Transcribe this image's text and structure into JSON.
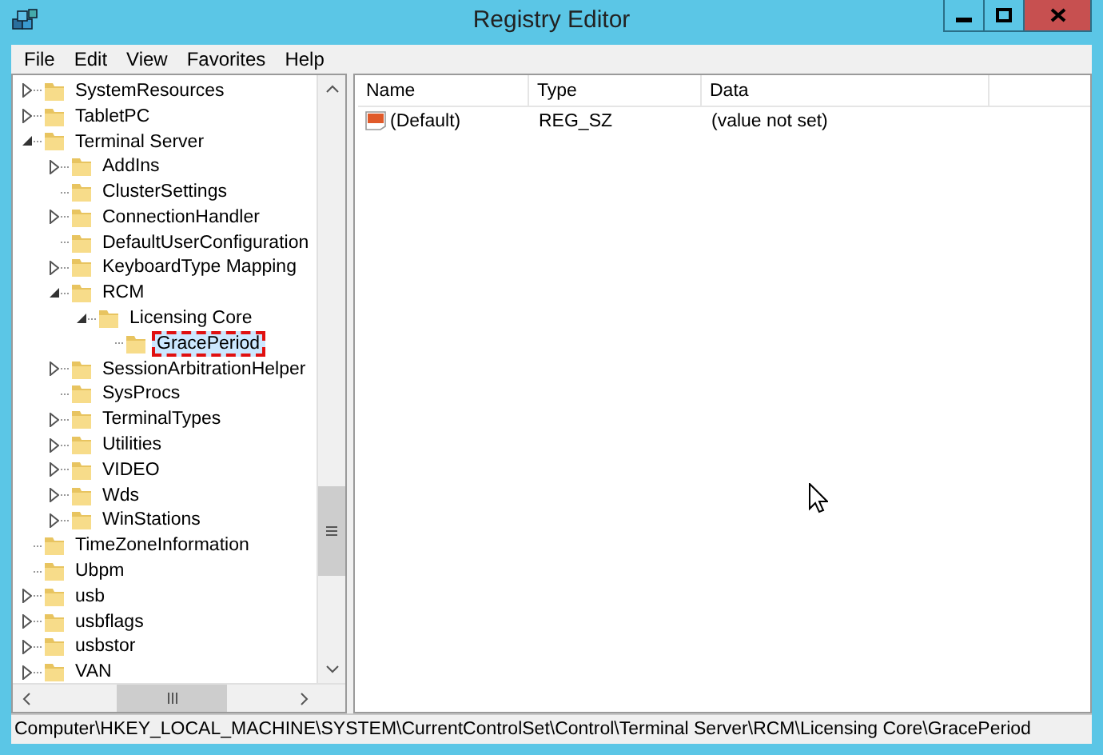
{
  "window": {
    "title": "Registry Editor"
  },
  "menu": [
    "File",
    "Edit",
    "View",
    "Favorites",
    "Help"
  ],
  "tree": [
    {
      "label": "SystemResources",
      "expandable": true,
      "expanded": false,
      "selected": false
    },
    {
      "label": "TabletPC",
      "expandable": true,
      "expanded": false,
      "selected": false
    },
    {
      "label": "Terminal Server",
      "expandable": true,
      "expanded": true,
      "selected": false,
      "children": [
        {
          "label": "AddIns",
          "expandable": true,
          "expanded": false,
          "selected": false
        },
        {
          "label": "ClusterSettings",
          "expandable": false,
          "selected": false
        },
        {
          "label": "ConnectionHandler",
          "expandable": true,
          "expanded": false,
          "selected": false
        },
        {
          "label": "DefaultUserConfiguration",
          "expandable": false,
          "selected": false
        },
        {
          "label": "KeyboardType Mapping",
          "expandable": true,
          "expanded": false,
          "selected": false
        },
        {
          "label": "RCM",
          "expandable": true,
          "expanded": true,
          "selected": false,
          "children": [
            {
              "label": "Licensing Core",
              "expandable": true,
              "expanded": true,
              "selected": false,
              "children": [
                {
                  "label": "GracePeriod",
                  "expandable": false,
                  "selected": true
                }
              ]
            }
          ]
        },
        {
          "label": "SessionArbitrationHelper",
          "expandable": true,
          "expanded": false,
          "selected": false
        },
        {
          "label": "SysProcs",
          "expandable": false,
          "selected": false
        },
        {
          "label": "TerminalTypes",
          "expandable": true,
          "expanded": false,
          "selected": false
        },
        {
          "label": "Utilities",
          "expandable": true,
          "expanded": false,
          "selected": false
        },
        {
          "label": "VIDEO",
          "expandable": true,
          "expanded": false,
          "selected": false
        },
        {
          "label": "Wds",
          "expandable": true,
          "expanded": false,
          "selected": false
        },
        {
          "label": "WinStations",
          "expandable": true,
          "expanded": false,
          "selected": false
        }
      ]
    },
    {
      "label": "TimeZoneInformation",
      "expandable": false,
      "selected": false
    },
    {
      "label": "Ubpm",
      "expandable": false,
      "selected": false
    },
    {
      "label": "usb",
      "expandable": true,
      "expanded": false,
      "selected": false
    },
    {
      "label": "usbflags",
      "expandable": true,
      "expanded": false,
      "selected": false
    },
    {
      "label": "usbstor",
      "expandable": true,
      "expanded": false,
      "selected": false
    },
    {
      "label": "VAN",
      "expandable": true,
      "expanded": false,
      "selected": false
    }
  ],
  "list": {
    "columns": [
      "Name",
      "Type",
      "Data"
    ],
    "rows": [
      {
        "name": "(Default)",
        "type": "REG_SZ",
        "data": "(value not set)"
      }
    ]
  },
  "status_bar": "Computer\\HKEY_LOCAL_MACHINE\\SYSTEM\\CurrentControlSet\\Control\\Terminal Server\\RCM\\Licensing Core\\GracePeriod"
}
